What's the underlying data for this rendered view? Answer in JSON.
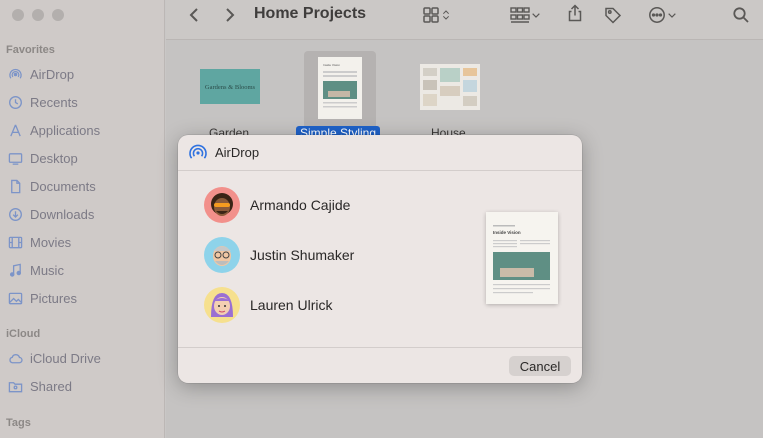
{
  "window": {
    "title": "Home Projects",
    "sidebar": {
      "sections": [
        {
          "label": "Favorites",
          "items": [
            {
              "label": "AirDrop",
              "icon": "airdrop-icon"
            },
            {
              "label": "Recents",
              "icon": "clock-icon"
            },
            {
              "label": "Applications",
              "icon": "applications-icon"
            },
            {
              "label": "Desktop",
              "icon": "desktop-icon"
            },
            {
              "label": "Documents",
              "icon": "document-icon"
            },
            {
              "label": "Downloads",
              "icon": "download-icon"
            },
            {
              "label": "Movies",
              "icon": "film-icon"
            },
            {
              "label": "Music",
              "icon": "music-note-icon"
            },
            {
              "label": "Pictures",
              "icon": "photo-icon"
            }
          ]
        },
        {
          "label": "iCloud",
          "items": [
            {
              "label": "iCloud Drive",
              "icon": "cloud-icon"
            },
            {
              "label": "Shared",
              "icon": "shared-folder-icon"
            }
          ]
        },
        {
          "label": "Tags",
          "items": []
        }
      ]
    },
    "files": [
      {
        "label": "Garden",
        "selected": false,
        "thumb_text": "Gardens & Blooms"
      },
      {
        "label": "Simple Styling",
        "selected": true,
        "thumb_text": "Inside Vision"
      },
      {
        "label": "House",
        "selected": false
      }
    ]
  },
  "airdrop": {
    "title": "AirDrop",
    "people": [
      {
        "name": "Armando Cajide",
        "avatar_bg": "#f2908b"
      },
      {
        "name": "Justin Shumaker",
        "avatar_bg": "#8ed3ea"
      },
      {
        "name": "Lauren Ulrick",
        "avatar_bg": "#f6e08e"
      }
    ],
    "preview_title": "Inside Vision",
    "cancel_label": "Cancel"
  },
  "colors": {
    "selection": "#1f62c9",
    "airdrop_blue": "#2f72e0"
  }
}
